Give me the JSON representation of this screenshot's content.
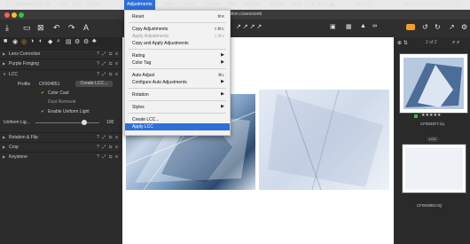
{
  "menubar": {
    "apple": "",
    "app_name": "Capture One 12",
    "items": [
      "File",
      "Edit",
      "Image",
      "Adjustments",
      "Layer",
      "Select",
      "Camera",
      "View",
      "Window",
      "Scripts",
      "Help"
    ],
    "active": "Adjustments",
    "status": {
      "battery": "100 %",
      "datetime": "Wed 19 Dec  11:12"
    }
  },
  "window": {
    "title_fragment": "ation.cosessionb"
  },
  "menu": {
    "items": [
      {
        "label": "Reset",
        "shortcut": "⌘R"
      },
      {
        "label": "Copy Adjustments",
        "shortcut": "⇧⌘C"
      },
      {
        "label": "Apply Adjustments",
        "shortcut": "⇧⌘V",
        "disabled": true
      },
      {
        "label": "Copy and Apply Adjustments"
      },
      {
        "label": "Rating",
        "submenu": true
      },
      {
        "label": "Color Tag",
        "submenu": true
      },
      {
        "label": "Auto Adjust",
        "shortcut": "⌘L"
      },
      {
        "label": "Configure Auto Adjustments",
        "submenu": true
      },
      {
        "label": "Rotation",
        "submenu": true
      },
      {
        "label": "Styles",
        "submenu": true
      },
      {
        "label": "Create LCC..."
      },
      {
        "label": "Apply LCC",
        "highlighted": true
      }
    ]
  },
  "left_panel": {
    "tools": [
      {
        "label": "Lens Correction"
      },
      {
        "label": "Purple Fringing"
      },
      {
        "label": "LCC"
      }
    ],
    "lcc": {
      "profile_label": "Profile",
      "profile_value": "CF004851",
      "create_lcc_button": "Create LCC...",
      "color_cast": "Color Cast",
      "dust_removal": "Dust Removal",
      "uniform_light": "Enable Uniform Light",
      "uniform_light_label": "Uniform Lig...",
      "uniform_light_value": "100"
    },
    "tools_after": [
      {
        "label": "Rotation & Flip"
      },
      {
        "label": "Crop"
      },
      {
        "label": "Keystone"
      }
    ]
  },
  "browser": {
    "counter": "2 of 2",
    "thumbs": [
      {
        "name": "CF004877.iiq",
        "rating": "★★★★★",
        "tag_color": "#2ec04a"
      },
      {
        "name": "CF004883.IIQ",
        "badge": "LCC"
      }
    ]
  },
  "colors": {
    "accent": "#2e6fd8",
    "panel": "#2c2c2c"
  }
}
